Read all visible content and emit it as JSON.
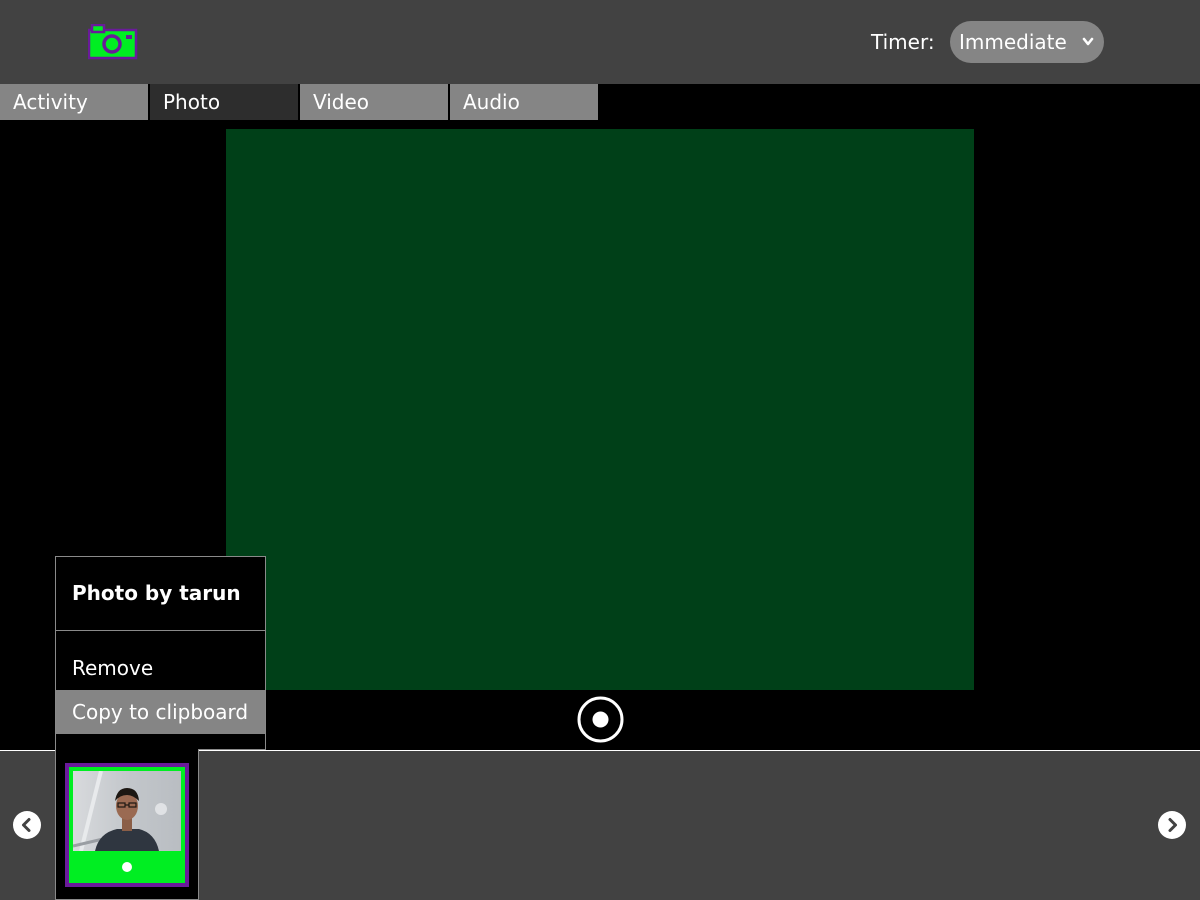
{
  "toolbar": {
    "activity_icon": "camera-icon",
    "timer_label": "Timer:",
    "timer_value": "Immediate",
    "timer_icon": "chevron-down-icon"
  },
  "tabs": [
    {
      "label": "Activity",
      "active": false
    },
    {
      "label": "Photo",
      "active": true
    },
    {
      "label": "Video",
      "active": false
    },
    {
      "label": "Audio",
      "active": false
    }
  ],
  "palette": {
    "title": "Photo by tarun",
    "items": [
      {
        "label": "Remove",
        "highlighted": false
      },
      {
        "label": "Copy to clipboard",
        "highlighted": true
      }
    ]
  },
  "tray": {
    "left_icon": "chevron-left-icon",
    "right_icon": "chevron-right-icon",
    "thumbnail_icon": "photo-thumbnail"
  },
  "colors": {
    "toolbar_bg": "#424242",
    "preview_bg": "#004018",
    "accent_green": "#00ee22",
    "accent_purple": "#6a1b9a",
    "tab_bg": "#858585",
    "tab_active_bg": "#2d2d2d"
  }
}
